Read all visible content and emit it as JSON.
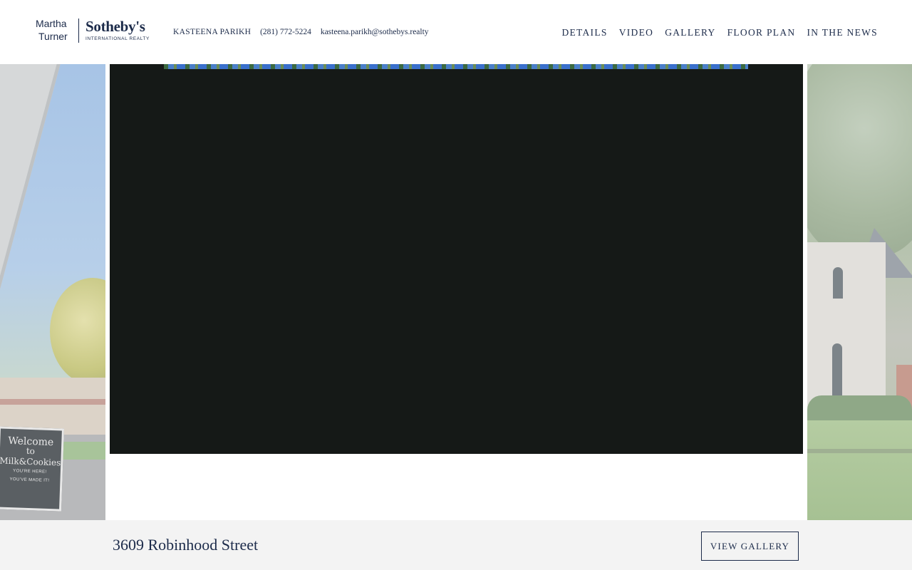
{
  "header": {
    "logo": {
      "line1": "Martha",
      "line2": "Turner",
      "brand": "Sotheby's",
      "subtitle": "INTERNATIONAL REALTY"
    },
    "agent": {
      "name": "KASTEENA PARIKH",
      "phone": "(281) 772-5224",
      "email": "kasteena.parikh@sothebys.realty"
    },
    "nav": [
      "DETAILS",
      "VIDEO",
      "GALLERY",
      "FLOOR PLAN",
      "IN THE NEWS"
    ]
  },
  "carousel": {
    "left_slide_sign": {
      "line1": "Welcome",
      "line2": "to",
      "line3": "Milk&Cookies",
      "line4": "YOU'RE HERE!",
      "line5": "YOU'VE MADE IT!"
    }
  },
  "footer": {
    "address": "3609 Robinhood Street",
    "button_label": "VIEW GALLERY"
  },
  "colors": {
    "brand_navy": "#1c2b4a",
    "video_background": "#151917",
    "footer_background": "#f3f3f3"
  }
}
